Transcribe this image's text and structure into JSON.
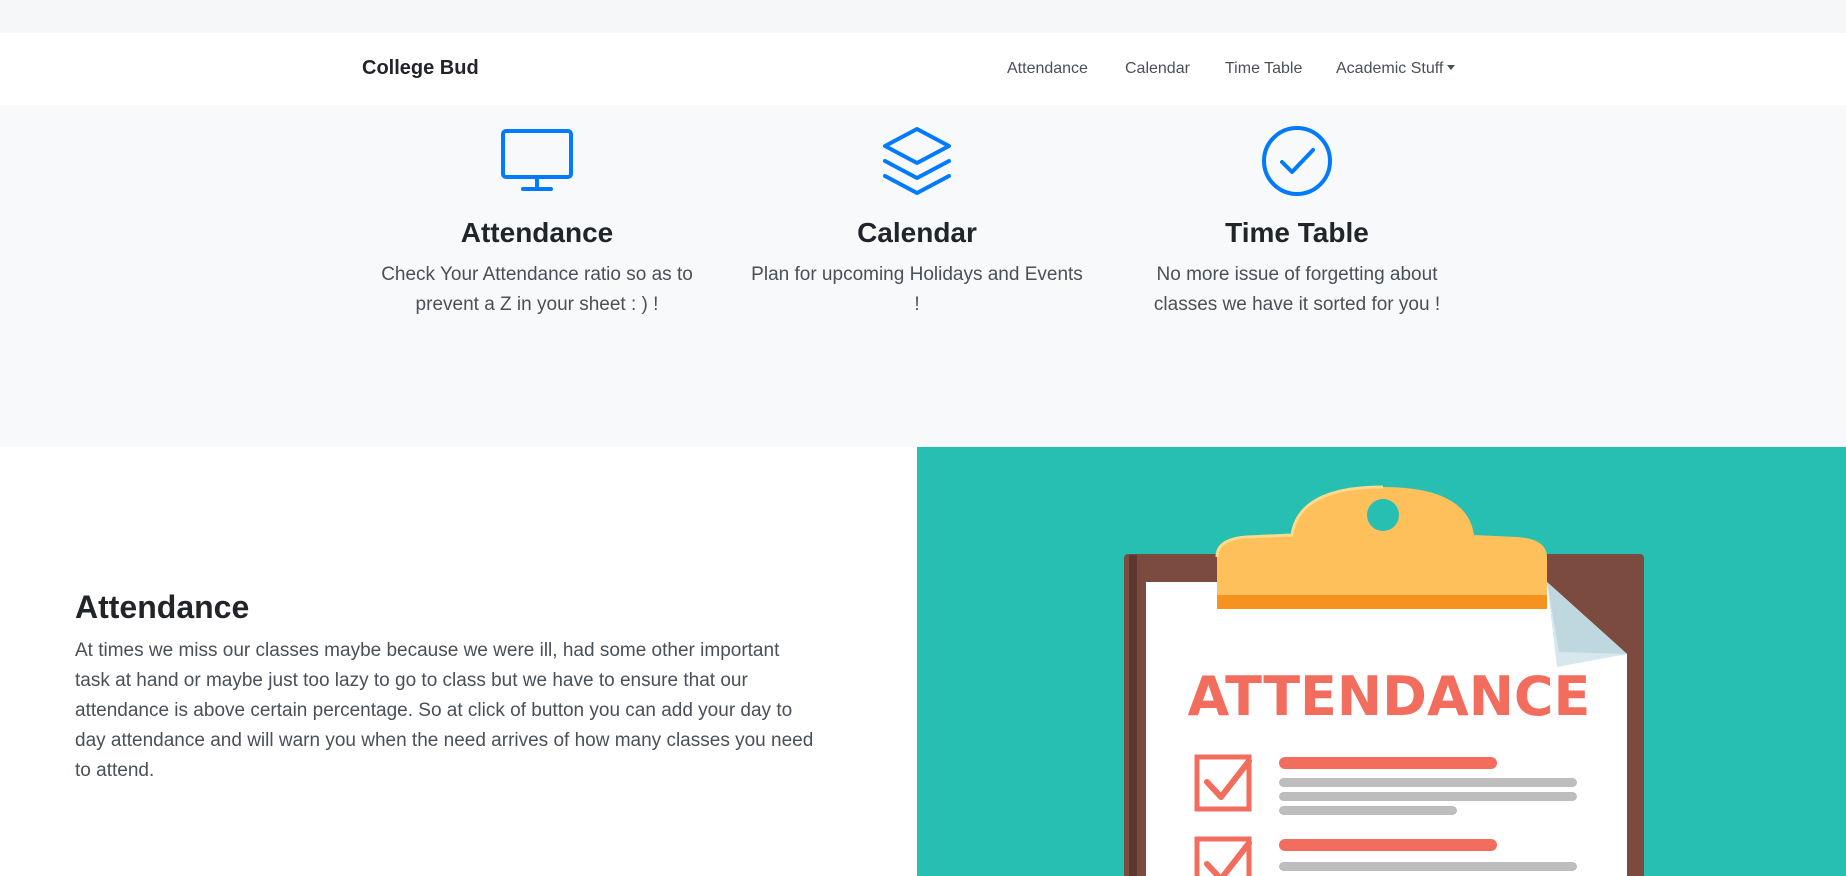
{
  "navbar": {
    "brand": "College Bud",
    "links": [
      "Attendance",
      "Calendar",
      "Time Table",
      "Academic Stuff"
    ]
  },
  "features": [
    {
      "icon": "monitor-icon",
      "title": "Attendance",
      "text": "Check Your Attendance ratio  so as to prevent a Z in your sheet : ) !"
    },
    {
      "icon": "layers-icon",
      "title": "Calendar",
      "text": "Plan for upcoming Holidays and Events !"
    },
    {
      "icon": "check-circle-icon",
      "title": "Time Table",
      "text": "No more issue of forgetting about classes we have it sorted for you !"
    }
  ],
  "showcase": {
    "title": "Attendance",
    "text": "At times we miss our classes maybe because we were ill, had some other important task at hand or maybe just too lazy to go to class but we have to ensure that our attendance is above certain percentage. So at click of button you can add your day to day attendance and will warn you when the need arrives of how many classes you need to attend.",
    "image_text": "ATTENDANCE"
  },
  "colors": {
    "accent": "#007bff",
    "teal": "#26bfb1",
    "clipboard_board": "#7b4b40",
    "clip": "#fec05a",
    "attendance_red": "#f26d5d"
  }
}
